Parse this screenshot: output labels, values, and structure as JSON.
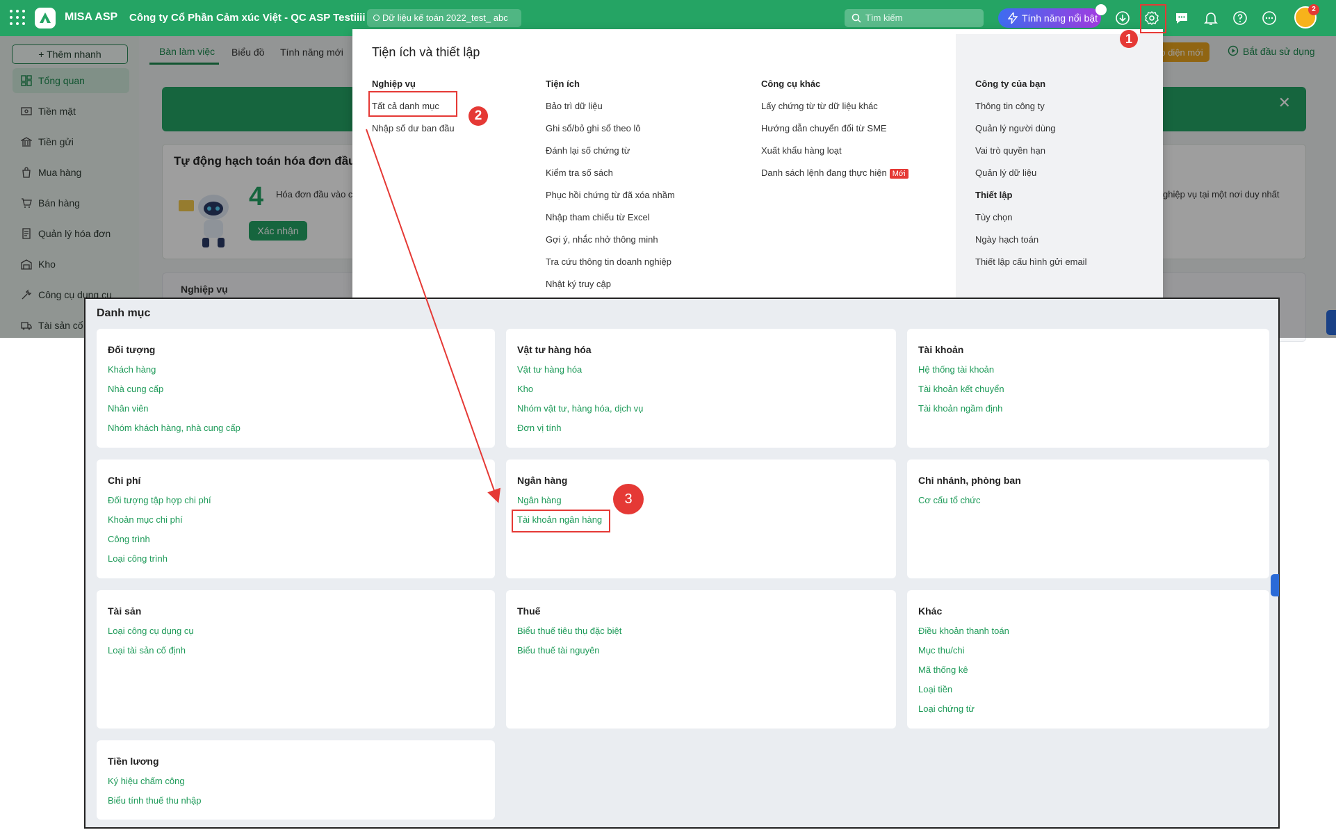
{
  "topbar": {
    "app_name": "MISA ASP",
    "company_name": "Công ty Cổ Phần Cảm xúc Việt - QC ASP Testiiii",
    "data_pill": "Dữ liệu kế toán 2022_test_ abc",
    "search_placeholder": "Tìm kiếm",
    "feature_button": "Tính năng nổi bật",
    "avatar_badge": "2",
    "accent_color": "#25a464"
  },
  "sidebar": {
    "quick_add": "+ Thêm nhanh",
    "items": [
      {
        "label": "Tổng quan",
        "icon": "dashboard-icon"
      },
      {
        "label": "Tiền mặt",
        "icon": "cash-icon"
      },
      {
        "label": "Tiền gửi",
        "icon": "bank-icon"
      },
      {
        "label": "Mua hàng",
        "icon": "shopping-bag-icon"
      },
      {
        "label": "Bán hàng",
        "icon": "cart-icon"
      },
      {
        "label": "Quản lý hóa đơn",
        "icon": "invoice-icon"
      },
      {
        "label": "Kho",
        "icon": "warehouse-icon"
      },
      {
        "label": "Công cụ dụng cụ",
        "icon": "tools-icon"
      },
      {
        "label": "Tài sản cố",
        "icon": "truck-icon"
      }
    ]
  },
  "tabs": [
    "Bàn làm việc",
    "Biểu đồ",
    "Tính năng mới"
  ],
  "top_right": {
    "button1": "o diện mới",
    "button2": "Bắt đầu sử dụng"
  },
  "main": {
    "auto_title": "Tự động hạch toán hóa đơn đầu v",
    "auto_count": "4",
    "auto_desc": "Hóa đơn đầu vào c",
    "confirm_button": "Xác nhận",
    "right_text": "ghiệp vụ tại một nơi duy nhất",
    "nghiep_vu": "Nghiệp vụ"
  },
  "dropdown": {
    "title": "Tiện ích và thiết lập",
    "col1": {
      "heading": "Nghiệp vụ",
      "items": [
        "Tất cả danh mục",
        "Nhập số dư ban đầu"
      ]
    },
    "col2": {
      "heading": "Tiện ích",
      "items": [
        "Bảo trì dữ liệu",
        "Ghi sổ/bỏ ghi sổ theo lô",
        "Đánh lại số chứng từ",
        "Kiểm tra số sách",
        "Phục hồi chứng từ đã xóa nhầm",
        "Nhập tham chiếu từ Excel",
        "Gợi ý, nhắc nhở thông minh",
        "Tra cứu thông tin doanh nghiệp",
        "Nhật ký truy cập"
      ]
    },
    "col3": {
      "heading": "Công cụ khác",
      "items": [
        "Lấy chứng từ từ dữ liệu khác",
        "Hướng dẫn chuyển đổi từ SME",
        "Xuất khẩu hàng loạt",
        "Danh sách lệnh đang thực hiện"
      ],
      "new_badge": "Mới"
    },
    "col4": {
      "heading": "Công ty của bạn",
      "items": [
        "Thông tin công ty",
        "Quản lý người dùng",
        "Vai trò quyền hạn",
        "Quản lý dữ liệu"
      ],
      "heading2": "Thiết lập",
      "items2": [
        "Tùy chọn",
        "Ngày hạch toán",
        "Thiết lập cấu hình gửi email"
      ]
    }
  },
  "catalog": {
    "title": "Danh mục",
    "cards": [
      {
        "heading": "Đối tượng",
        "links": [
          "Khách hàng",
          "Nhà cung cấp",
          "Nhân viên",
          "Nhóm khách hàng, nhà cung cấp"
        ]
      },
      {
        "heading": "Vật tư hàng hóa",
        "links": [
          "Vật tư hàng hóa",
          "Kho",
          "Nhóm vật tư, hàng hóa, dịch vụ",
          "Đơn vị tính"
        ]
      },
      {
        "heading": "Tài khoản",
        "links": [
          "Hệ thống tài khoản",
          "Tài khoản kết chuyển",
          "Tài khoản ngầm định"
        ]
      },
      {
        "heading": "Chi phí",
        "links": [
          "Đối tượng tập hợp chi phí",
          "Khoản mục chi phí",
          "Công trình",
          "Loại công trình"
        ]
      },
      {
        "heading": "Ngân hàng",
        "links": [
          "Ngân hàng",
          "Tài khoản ngân hàng"
        ]
      },
      {
        "heading": "Chi nhánh, phòng ban",
        "links": [
          "Cơ cấu tổ chức"
        ]
      },
      {
        "heading": "Tài sản",
        "links": [
          "Loại công cụ dụng cụ",
          "Loại tài sản cố định"
        ]
      },
      {
        "heading": "Thuế",
        "links": [
          "Biểu thuế tiêu thụ đặc biệt",
          "Biểu thuế tài nguyên"
        ]
      },
      {
        "heading": "Khác",
        "links": [
          "Điều khoản thanh toán",
          "Mục thu/chi",
          "Mã thống kê",
          "Loại tiền",
          "Loại chứng từ"
        ]
      },
      {
        "heading": "Tiền lương",
        "links": [
          "Ký hiệu chấm công",
          "Biểu tính thuế thu nhập"
        ]
      }
    ]
  },
  "annotations": {
    "step1": "1",
    "step2": "2",
    "step3": "3",
    "color": "#e53935"
  }
}
